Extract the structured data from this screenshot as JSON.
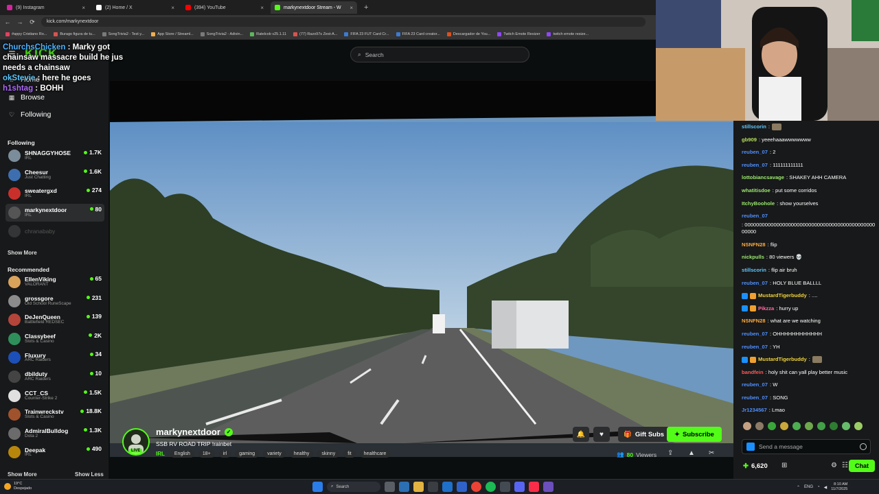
{
  "browser": {
    "tabs": [
      {
        "label": "(9) Instagram",
        "color": "#d6249f",
        "active": false
      },
      {
        "label": "(2) Home / X",
        "color": "#ffffff",
        "active": false
      },
      {
        "label": "(394) YouTube",
        "color": "#ff0000",
        "active": false
      },
      {
        "label": "markynextdoor Stream - W",
        "color": "#53fc18",
        "active": true
      }
    ],
    "url": "kick.com/markynextdoor",
    "bookmarks": [
      "#appy Cristiano Ro...",
      "Burago figura de tu...",
      "SongTrivia2 - Test y...",
      "App Store / Streaml...",
      "SongTrivia2 - Adivin...",
      "Ratelcob v25.1.11",
      "(77) Razo97s Zest-A...",
      "FIFA 23 FUT Card Cr...",
      "FIFA 23 Card creator...",
      "Descargador de You...",
      "Twitch Emote Resizer",
      "twitch emote resize..."
    ]
  },
  "overlay_chat": [
    {
      "user": "ChurchsChicken",
      "text": " : Marky got chainsaw massacre build he jus needs a chainsaw"
    },
    {
      "user": "okStevie",
      "text": " : here he goes"
    },
    {
      "user": "h1shtag",
      "text": " : BOHH"
    }
  ],
  "sidebar": {
    "logo": "KICK",
    "nav": {
      "home": "Home",
      "browse": "Browse",
      "following": "Following"
    },
    "following_title": "Following",
    "following": [
      {
        "name": "SHNAGGYHOSE",
        "category": "IRL",
        "viewers": "1.7K",
        "color": "#7b8d9a"
      },
      {
        "name": "Cheesur",
        "category": "Just Chatting",
        "viewers": "1.6K",
        "color": "#3d6fb0"
      },
      {
        "name": "sweatergxd",
        "category": "IRL",
        "viewers": "274",
        "color": "#c9302c"
      },
      {
        "name": "markynextdoor",
        "category": "IRL",
        "viewers": "80",
        "color": "#555555"
      },
      {
        "name": "chranababy",
        "category": "",
        "viewers": "",
        "color": "#777777"
      }
    ],
    "show_more": "Show More",
    "recommended_title": "Recommended",
    "recommended": [
      {
        "name": "EllenViking",
        "category": "VALORANT",
        "viewers": "65",
        "color": "#d9a35c"
      },
      {
        "name": "grossgore",
        "category": "Old School RuneScape",
        "viewers": "231",
        "color": "#8c8c8c"
      },
      {
        "name": "DeJenQueen",
        "category": "Battlefield REDSEC",
        "viewers": "139",
        "color": "#b5443a"
      },
      {
        "name": "Classybeef",
        "category": "Slots & Casino",
        "viewers": "2K",
        "color": "#2f8f5b"
      },
      {
        "name": "Fluxury",
        "category": "ARC Raiders",
        "viewers": "34",
        "color": "#1d4fb8"
      },
      {
        "name": "dbilduty",
        "category": "ARC Raiders",
        "viewers": "10",
        "color": "#444444"
      },
      {
        "name": "CCT_CS",
        "category": "Counter-Strike 2",
        "viewers": "1.5K",
        "color": "#e0e0e0"
      },
      {
        "name": "Trainwreckstv",
        "category": "Slots & Casino",
        "viewers": "18.8K",
        "color": "#a0522d"
      },
      {
        "name": "AdmiralBulldog",
        "category": "Dota 2",
        "viewers": "1.3K",
        "color": "#6b6b6b"
      },
      {
        "name": "Deepak",
        "category": "IRL",
        "viewers": "490",
        "color": "#b8860b"
      }
    ],
    "show_more_2": "Show More",
    "show_less": "Show Less"
  },
  "search": {
    "placeholder": "Search"
  },
  "stream": {
    "name": "markynextdoor",
    "title": "SSB RV ROAD TRIP !rainbet",
    "live_label": "LIVE",
    "category": "IRL",
    "tags": [
      "English",
      "18+",
      "irl",
      "gaming",
      "variety",
      "healthy",
      "skinny",
      "fit",
      "healthcare"
    ],
    "gift_subs": "Gift Subs",
    "subscribe": "Subscribe",
    "viewer_count": "80",
    "viewers_label": "Viewers"
  },
  "chat": {
    "messages": [
      {
        "user": "stillscorin",
        "text": ":",
        "color": "#5ec8ff",
        "emote": true
      },
      {
        "user": "gb909",
        "text": ": yeeehaaawwwwwww",
        "color": "#b4e05a"
      },
      {
        "user": "reuben_07",
        "text": ": 2",
        "color": "#4f8fff"
      },
      {
        "user": "reuben_07",
        "text": ": 111111111111",
        "color": "#4f8fff"
      },
      {
        "user": "lottobiancsavage",
        "text": ": SHAKEY AHH CAMERA",
        "color": "#9ae86e"
      },
      {
        "user": "whatitisdoe",
        "text": ": put some corridos",
        "color": "#9ae86e"
      },
      {
        "user": "ItchyBoohole",
        "text": ": show yourselves",
        "color": "#9ae86e"
      },
      {
        "user": "reuben_07",
        "text": ": 00000000000000000000000000000000000000000000000000",
        "color": "#4f8fff"
      },
      {
        "user": "NSNFN28",
        "text": ": flip",
        "color": "#ffab3d"
      },
      {
        "user": "nickpulls",
        "text": ": 80 viewers 💀",
        "color": "#9ae86e"
      },
      {
        "user": "stillscorin",
        "text": ": flip air bruh",
        "color": "#5ec8ff"
      },
      {
        "user": "reuben_07",
        "text": ": HOLY BLUE BALLLL",
        "color": "#4f8fff"
      },
      {
        "user": "MustardTigerbuddy",
        "text": ": ....",
        "color": "#f0d33d",
        "badges": 2
      },
      {
        "user": "Pikzza",
        "text": ": hurry up",
        "color": "#ff6aa0",
        "badges": 2
      },
      {
        "user": "NSNFN28",
        "text": ": what are we watching",
        "color": "#ffab3d"
      },
      {
        "user": "reuben_07",
        "text": ": OHHHHHHHHHHHH",
        "color": "#4f8fff"
      },
      {
        "user": "reuben_07",
        "text": ": YH",
        "color": "#4f8fff"
      },
      {
        "user": "MustardTigerbuddy",
        "text": ":",
        "color": "#f0d33d",
        "badges": 2,
        "emote": true
      },
      {
        "user": "bandfein",
        "text": ": holy shit can yall play better music",
        "color": "#ff5a5a"
      },
      {
        "user": "reuben_07",
        "text": ": W",
        "color": "#4f8fff"
      },
      {
        "user": "reuben_07",
        "text": ": SONG",
        "color": "#4f8fff"
      },
      {
        "user": "Jr1234567",
        "text": ": Lmao",
        "color": "#4f8fff"
      }
    ],
    "placeholder": "Send a message",
    "points": "6,620",
    "send_label": "Chat"
  },
  "taskbar": {
    "temp": "19°C",
    "weather": "Despejado",
    "search": "Search",
    "lang": "ENG",
    "time": "8:10 AM",
    "date": "11/7/2025"
  }
}
